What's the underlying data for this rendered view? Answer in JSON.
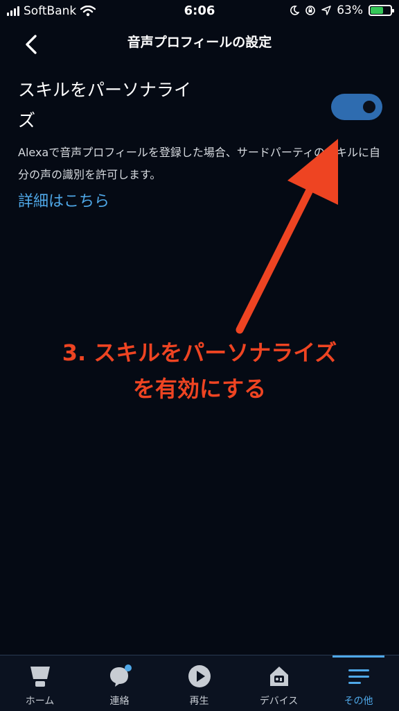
{
  "status_bar": {
    "carrier": "SoftBank",
    "time": "6:06",
    "battery": "63%",
    "battery_level": 0.63
  },
  "header": {
    "title": "音声プロフィールの設定",
    "back_icon": "chevron-left-icon"
  },
  "setting": {
    "title": "スキルをパーソナライズ",
    "enabled": true,
    "description": "Alexaで音声プロフィールを登録した場合、サードパーティのスキルに自分の声の識別を許可します。",
    "link": "詳細はこちら"
  },
  "annotation": {
    "line1": "3. スキルをパーソナライズ",
    "line2": "を有効にする",
    "color": "#ee4422"
  },
  "nav": {
    "items": [
      {
        "label": "ホーム",
        "icon": "home-icon"
      },
      {
        "label": "連絡",
        "icon": "chat-icon"
      },
      {
        "label": "再生",
        "icon": "play-icon"
      },
      {
        "label": "デバイス",
        "icon": "devices-icon"
      },
      {
        "label": "その他",
        "icon": "menu-icon",
        "active": true
      }
    ]
  },
  "colors": {
    "accent": "#4fa8e8",
    "toggle": "#2e6cb0",
    "background": "#050a14"
  }
}
